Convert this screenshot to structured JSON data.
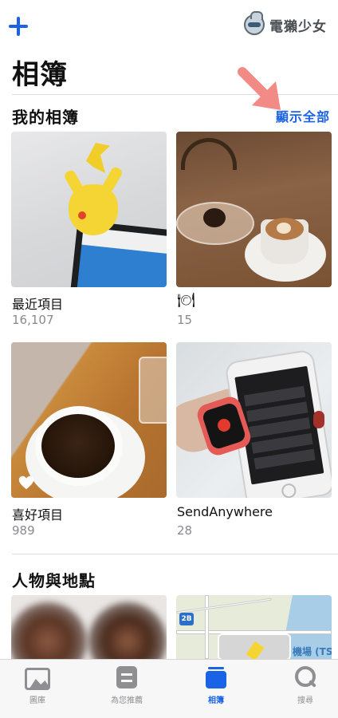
{
  "header": {
    "add_icon": "plus-icon",
    "watermark_text": "電獺少女",
    "title": "相簿"
  },
  "my_albums": {
    "section_title": "我的相簿",
    "show_all_label": "顯示全部",
    "items": [
      {
        "name": "最近項目",
        "count": "16,107"
      },
      {
        "name": "🍽",
        "count": "15"
      },
      {
        "name": "喜好項目",
        "count": "989"
      },
      {
        "name": "SendAnywhere",
        "count": "28"
      }
    ]
  },
  "people_places": {
    "section_title": "人物與地點",
    "map_label": "機場 (TS",
    "map_route_badge": "2B"
  },
  "tabbar": {
    "tabs": [
      {
        "label": "圖庫",
        "icon": "photo-library-icon",
        "active": false
      },
      {
        "label": "為您推薦",
        "icon": "for-you-icon",
        "active": false
      },
      {
        "label": "相簿",
        "icon": "albums-icon",
        "active": true
      },
      {
        "label": "搜尋",
        "icon": "search-icon",
        "active": false
      }
    ]
  },
  "colors": {
    "accent": "#1a63e6",
    "annotation_arrow": "#f28b85",
    "secondary_text": "#8a8a8e"
  }
}
